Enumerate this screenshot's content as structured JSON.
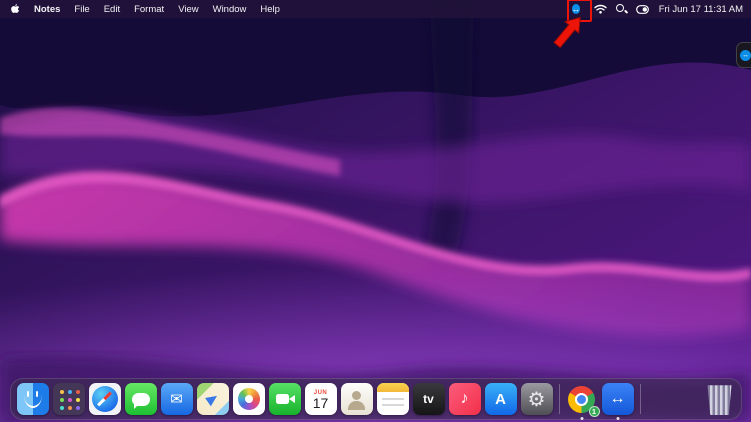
{
  "menu_bar": {
    "app_name": "Notes",
    "menus": [
      "File",
      "Edit",
      "Format",
      "View",
      "Window",
      "Help"
    ],
    "status_datetime": "Fri Jun 17  11:31 AM"
  },
  "glyphs": {
    "teamviewer": "↔",
    "mail": "✉",
    "music": "♪",
    "settings": "⚙",
    "appstore": "A",
    "appletv": "tv"
  },
  "annotation": {
    "color": "#ed1509"
  },
  "dock": {
    "apps": [
      "Finder",
      "Launchpad",
      "Safari",
      "Messages",
      "Mail",
      "Maps",
      "Photos",
      "FaceTime",
      "Calendar",
      "Contacts",
      "Notes",
      "TV",
      "Music",
      "App Store",
      "System Preferences",
      "Google Chrome",
      "TeamViewer"
    ],
    "calendar_month": "JUN",
    "calendar_day": "17",
    "chrome_badge": "1",
    "trash": "Trash"
  }
}
